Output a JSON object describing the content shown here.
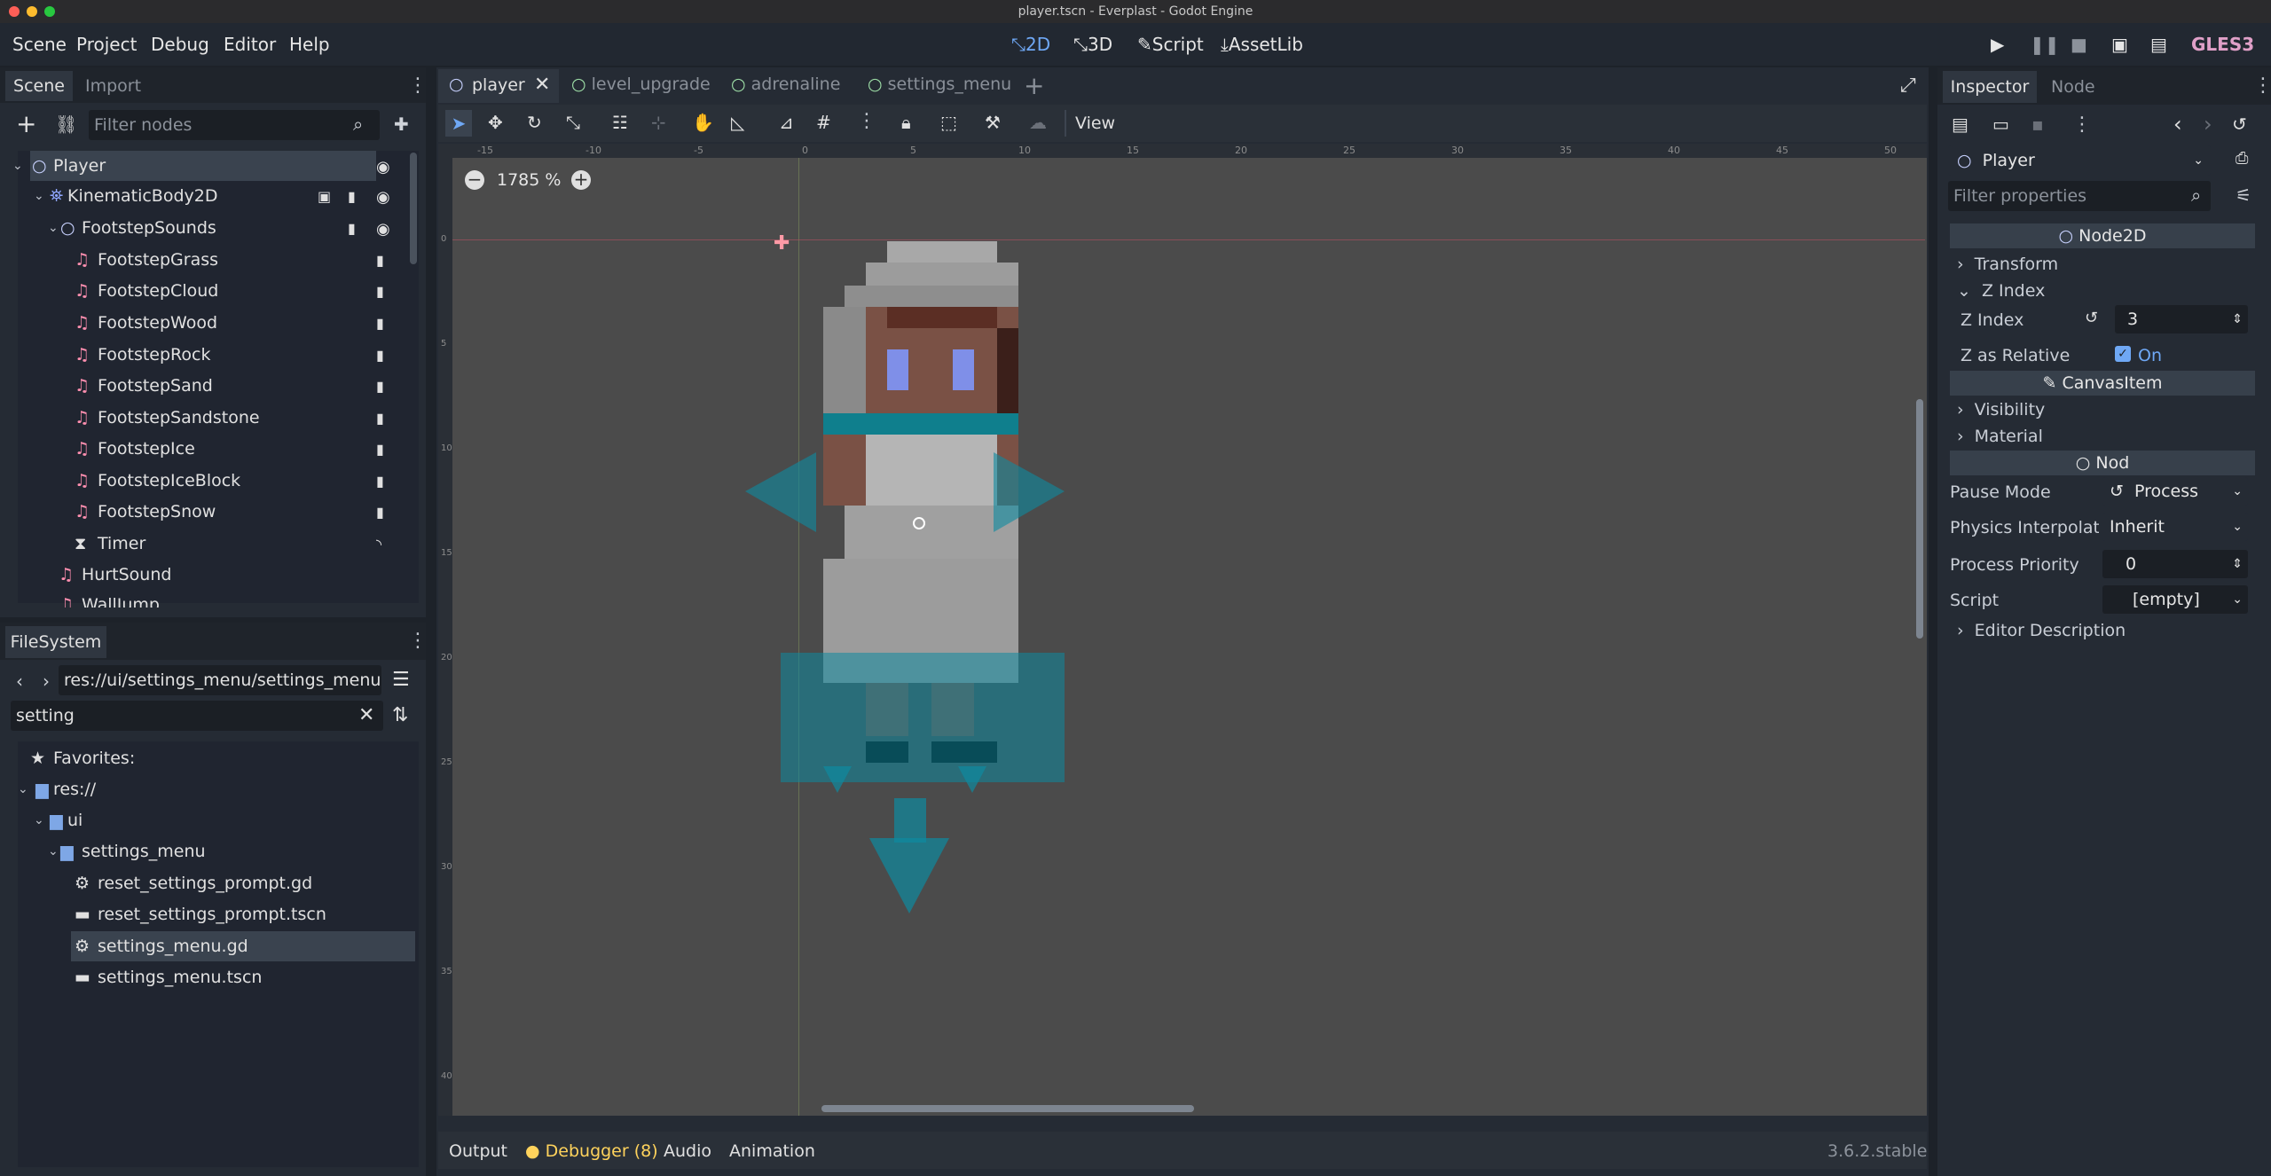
{
  "window": {
    "title": "player.tscn - Everplast - Godot Engine"
  },
  "menu": [
    "Scene",
    "Project",
    "Debug",
    "Editor",
    "Help"
  ],
  "workspaces": [
    "2D",
    "3D",
    "Script",
    "AssetLib"
  ],
  "renderer": "GLES3",
  "scene_panel": {
    "tabs": [
      "Scene",
      "Import"
    ],
    "filter_placeholder": "Filter nodes",
    "tree": [
      "Player",
      "KinematicBody2D",
      "FootstepSounds",
      "FootstepGrass",
      "FootstepCloud",
      "FootstepWood",
      "FootstepRock",
      "FootstepSand",
      "FootstepSandstone",
      "FootstepIce",
      "FootstepIceBlock",
      "FootstepSnow",
      "Timer",
      "HurtSound",
      "WallJump"
    ]
  },
  "filesystem": {
    "tab": "FileSystem",
    "path": "res://ui/settings_menu/settings_menu.g",
    "search": "setting",
    "items": [
      "Favorites:",
      "res://",
      "ui",
      "settings_menu",
      "reset_settings_prompt.gd",
      "reset_settings_prompt.tscn",
      "settings_menu.gd",
      "settings_menu.tscn"
    ]
  },
  "editor_tabs": [
    "player",
    "level_upgrade",
    "adrenaline",
    "settings_menu"
  ],
  "toolbar": {
    "view_label": "View"
  },
  "viewport": {
    "zoom": "1785 %",
    "ruler_labels": [
      "-15",
      "-10",
      "-5",
      "0",
      "5",
      "10",
      "15",
      "20",
      "25",
      "30",
      "35",
      "40",
      "45",
      "50"
    ],
    "vruler_labels": [
      "0",
      "5",
      "10",
      "15",
      "20",
      "25",
      "30",
      "35",
      "40"
    ]
  },
  "bottom_bar": {
    "tabs": [
      "Output",
      "Debugger (8)",
      "Audio",
      "Animation"
    ],
    "version": "3.6.2.stable"
  },
  "inspector": {
    "tabs": [
      "Inspector",
      "Node"
    ],
    "object": "Player",
    "filter_placeholder": "Filter properties",
    "node2d_header": "Node2D",
    "transform": "Transform",
    "zindex_group": "Z Index",
    "zindex_label": "Z Index",
    "zindex_value": "3",
    "zrel_label": "Z as Relative",
    "zrel_value": "On",
    "canvas_header": "CanvasItem",
    "visibility": "Visibility",
    "material": "Material",
    "node_header": "Nod",
    "pause_label": "Pause Mode",
    "pause_value": "Process",
    "physics_label": "Physics Interpolati",
    "physics_value": "Inherit",
    "priority_label": "Process Priority",
    "priority_value": "0",
    "script_label": "Script",
    "script_value": "[empty]",
    "editor_desc": "Editor Description"
  },
  "colors": {
    "accent": "#6fa8f5",
    "renderer": "#e0a0c8",
    "teal": "#0e8aa0"
  }
}
